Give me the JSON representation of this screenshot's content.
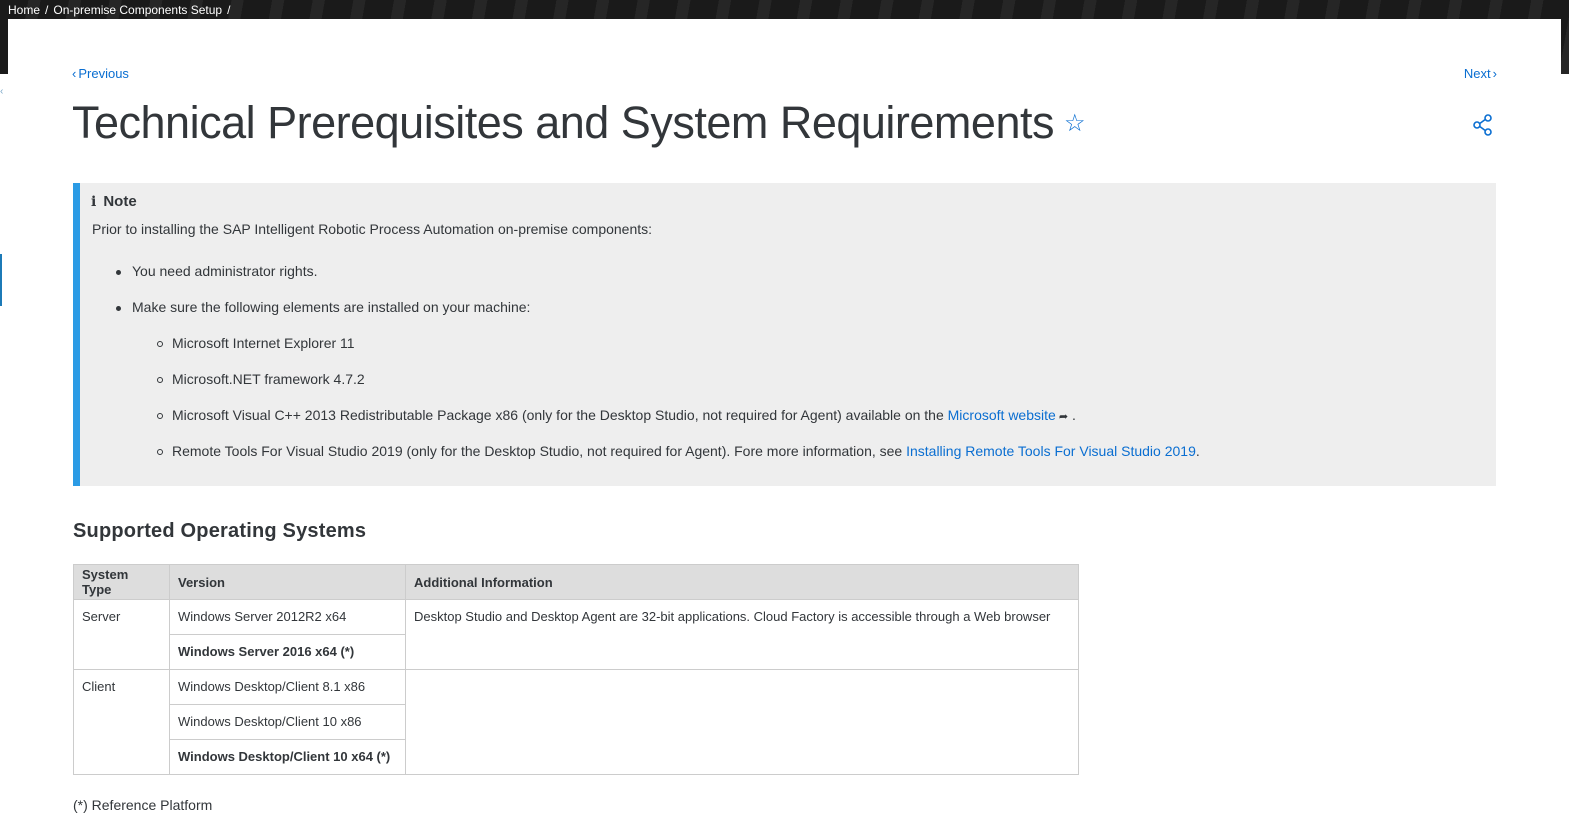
{
  "breadcrumb": {
    "home": "Home",
    "separator": "/",
    "section": "On-premise Components Setup"
  },
  "nav": {
    "previous": "Previous",
    "next": "Next"
  },
  "page": {
    "title": "Technical Prerequisites and System Requirements",
    "favorite_icon": "star-icon",
    "share_icon": "share-icon"
  },
  "note": {
    "heading": "Note",
    "intro": "Prior to installing the SAP Intelligent Robotic Process Automation on-premise components:",
    "item1": "You need administrator rights.",
    "item2": "Make sure the following elements are installed on your machine:",
    "sub1": "Microsoft Internet Explorer 11",
    "sub2": "Microsoft.NET framework 4.7.2",
    "sub3_text": "Microsoft Visual C++ 2013 Redistributable Package x86 (only for the Desktop Studio, not required for Agent) available on the ",
    "sub3_link": "Microsoft website",
    "sub3_end": " .",
    "sub4_text": "Remote Tools For Visual Studio 2019 (only for the Desktop Studio, not required for Agent). Fore more information, see ",
    "sub4_link": "Installing Remote Tools For Visual Studio 2019",
    "sub4_end": "."
  },
  "section": {
    "title": "Supported Operating Systems"
  },
  "table": {
    "headers": [
      "System Type",
      "Version",
      "Additional Information"
    ],
    "server": {
      "type": "Server",
      "versions": [
        "Windows Server 2012R2 x64",
        "Windows Server 2016 x64 (*)"
      ],
      "info": "Desktop Studio and Desktop Agent are 32-bit applications. Cloud Factory is accessible through a Web browser"
    },
    "client": {
      "type": "Client",
      "versions": [
        "Windows Desktop/Client 8.1 x86",
        "Windows Desktop/Client 10 x86",
        "Windows Desktop/Client 10 x64 (*)"
      ]
    }
  },
  "footnote": "(*) Reference Platform",
  "colors": {
    "link": "#0a6ed1",
    "note_bar": "#2b9be5",
    "note_bg": "#eeeeee",
    "text": "#32363a"
  }
}
